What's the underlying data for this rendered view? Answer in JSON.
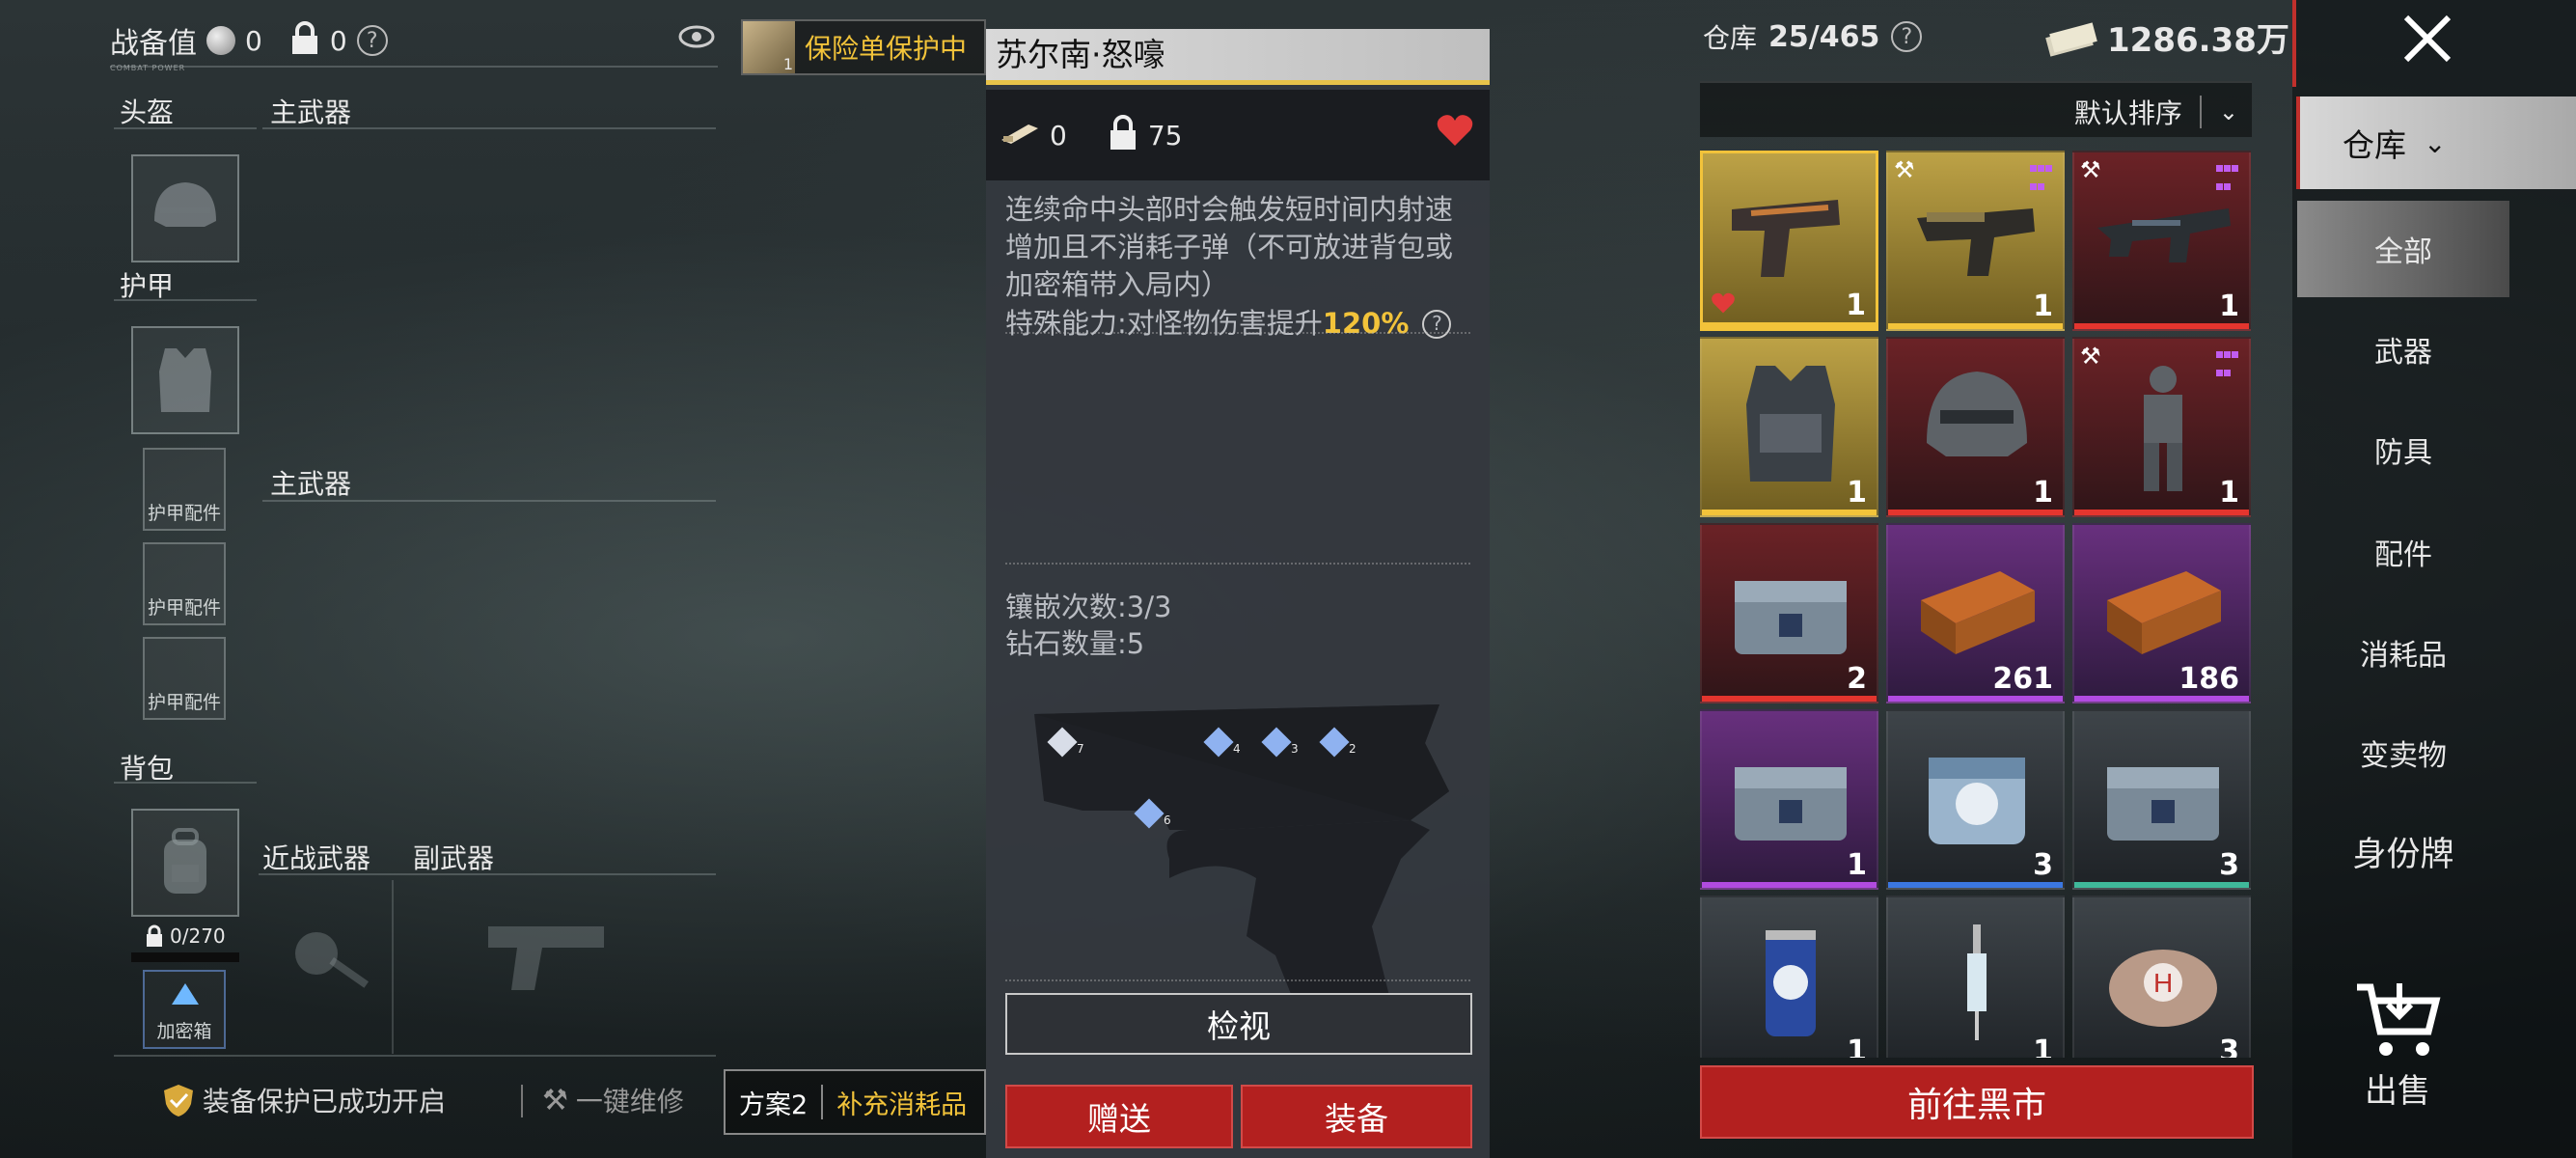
{
  "top_bar": {
    "combat_value_label": "战备值",
    "combat_value_sub": "COMBAT POWER",
    "coin_value": "0",
    "lock_value": "0",
    "help_icon": "question-circle-icon",
    "eye_icon": "eye-icon",
    "insurance_count": "1",
    "insurance_text": "保险单保护中"
  },
  "loadout": {
    "helmet_label": "头盔",
    "primary_label": "主武器",
    "armor_label": "护甲",
    "armor_accessory": "护甲配件",
    "primary_label_2": "主武器",
    "backpack_label": "背包",
    "backpack_capacity": "0/270",
    "secure_case_label": "加密箱",
    "melee_label": "近战武器",
    "secondary_label": "副武器"
  },
  "bottom_left": {
    "protection_text": "装备保护已成功开启",
    "repair_text": "一键维修",
    "plan_label": "方案2",
    "refill_label": "补充消耗品"
  },
  "detail": {
    "title": "苏尔南·怒嚎",
    "ammo_value": "0",
    "weight_value": "75",
    "description": "连续命中头部时会触发短时间内射速增加且不消耗子弹（不可放进背包或加密箱带入局内）",
    "ability_prefix": "特殊能力:对怪物伤害提升",
    "ability_value": "120%",
    "inlay_text": "镶嵌次数:3/3",
    "diamond_text": "钻石数量:5",
    "gem_labels": [
      "7",
      "4",
      "3",
      "2",
      "6"
    ],
    "inspect_button": "检视",
    "gift_button": "赠送",
    "equip_button": "装备"
  },
  "warehouse": {
    "label": "仓库",
    "capacity": "25/465",
    "money": "1286.38万",
    "sort_label": "默认排序",
    "blackmarket_button": "前往黑市",
    "items": [
      {
        "name": "pistol",
        "qty": "1",
        "rarity": "gold",
        "icon": "pistol-icon",
        "favorite": true,
        "tool": false,
        "slots": false
      },
      {
        "name": "smg",
        "qty": "1",
        "rarity": "gold",
        "icon": "smg-icon",
        "favorite": false,
        "tool": true,
        "slots": true
      },
      {
        "name": "rifle",
        "qty": "1",
        "rarity": "red",
        "icon": "rifle-icon",
        "favorite": false,
        "tool": true,
        "slots": true
      },
      {
        "name": "armor-vest",
        "qty": "1",
        "rarity": "gold",
        "icon": "vest-icon",
        "favorite": false,
        "tool": false,
        "slots": false
      },
      {
        "name": "helmet",
        "qty": "1",
        "rarity": "red",
        "icon": "helmet-icon",
        "favorite": false,
        "tool": false,
        "slots": false
      },
      {
        "name": "armor-suit",
        "qty": "1",
        "rarity": "red",
        "icon": "armor-suit-icon",
        "favorite": false,
        "tool": true,
        "slots": true
      },
      {
        "name": "steel-case",
        "qty": "2",
        "rarity": "red",
        "icon": "case-icon",
        "favorite": false,
        "tool": false,
        "slots": false
      },
      {
        "name": "ammo-box",
        "qty": "261",
        "rarity": "purple",
        "icon": "ammo-box-icon",
        "favorite": false,
        "tool": false,
        "slots": false
      },
      {
        "name": "ammo-box-2",
        "qty": "186",
        "rarity": "purple",
        "icon": "ammo-box-icon",
        "favorite": false,
        "tool": false,
        "slots": false
      },
      {
        "name": "orange-case",
        "qty": "1",
        "rarity": "purple",
        "icon": "case-icon",
        "favorite": false,
        "tool": false,
        "slots": false
      },
      {
        "name": "cooler-box",
        "qty": "3",
        "rarity": "dark-blue",
        "icon": "cooler-icon",
        "favorite": false,
        "tool": false,
        "slots": false
      },
      {
        "name": "black-case",
        "qty": "3",
        "rarity": "dark-teal",
        "icon": "case-icon",
        "favorite": false,
        "tool": false,
        "slots": false
      },
      {
        "name": "energy-drink",
        "qty": "1",
        "rarity": "dark",
        "icon": "can-icon",
        "favorite": false,
        "tool": false,
        "slots": false
      },
      {
        "name": "syringe",
        "qty": "1",
        "rarity": "dark",
        "icon": "syringe-icon",
        "favorite": false,
        "tool": false,
        "slots": false
      },
      {
        "name": "medkit",
        "qty": "3",
        "rarity": "dark",
        "icon": "medkit-icon",
        "favorite": false,
        "tool": false,
        "slots": false
      }
    ]
  },
  "side_tabs": {
    "warehouse_tab": "仓库",
    "all": "全部",
    "weapons": "武器",
    "armor": "防具",
    "accessories": "配件",
    "consumables": "消耗品",
    "valuables": "变卖物",
    "id_tag": "身份牌",
    "sell": "出售"
  },
  "colors": {
    "accent_gold": "#f2c33a",
    "red_button": "#b3201f",
    "heart": "#e23a3a"
  }
}
